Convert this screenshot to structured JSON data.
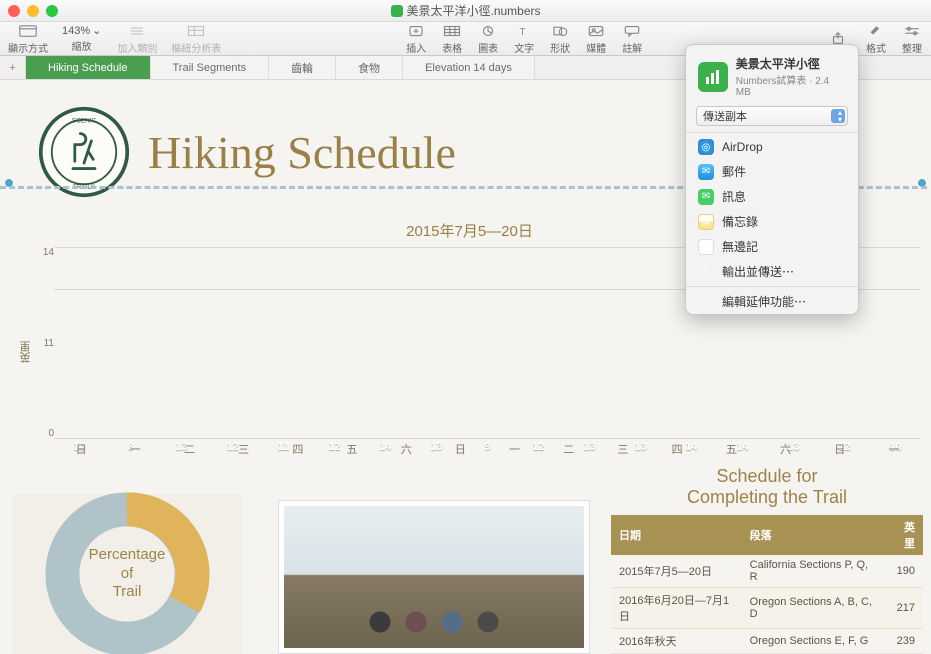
{
  "window": {
    "doc_title": "美景太平洋小徑.numbers"
  },
  "toolbar": {
    "view": "顯示方式",
    "zoom_level": "143%",
    "zoom_label": "縮放",
    "add_category": "加入類別",
    "pivot": "樞紐分析表",
    "insert": "插入",
    "table": "表格",
    "chart": "圖表",
    "text": "文字",
    "shape": "形狀",
    "media": "媒體",
    "comment": "註解",
    "share": "",
    "format": "格式",
    "organize": "整理"
  },
  "sheets": [
    "Hiking Schedule",
    "Trail Segments",
    "齒輪",
    "食物",
    "Elevation 14 days"
  ],
  "header": {
    "badge_top": "SCENIC",
    "badge_mid": "PACIFIC",
    "badge_bottom": "TRAILS",
    "title": "Hiking Schedule"
  },
  "chart_data": {
    "type": "bar",
    "subtitle": "2015年7月5—20日",
    "ylabel": "英里",
    "y_ticks": [
      14,
      11,
      0
    ],
    "ylim": [
      0,
      14
    ],
    "categories": [
      "日",
      "一",
      "二",
      "三",
      "四",
      "五",
      "六",
      "日",
      "一",
      "二",
      "三",
      "四",
      "五",
      "六",
      "日",
      "一"
    ],
    "values": [
      10,
      8,
      13,
      12,
      11,
      12,
      14,
      13,
      9,
      12,
      13,
      13,
      14,
      14,
      13,
      12,
      10
    ],
    "colors": [
      "c1",
      "c2",
      "c1",
      "c2",
      "c1",
      "c2",
      "c1",
      "c2",
      "c1",
      "c2",
      "c1",
      "c2",
      "c1",
      "c2",
      "c1",
      "c2",
      "c1"
    ]
  },
  "donut": {
    "line1": "Percentage",
    "line2": "of",
    "line3": "Trail"
  },
  "schedule": {
    "title1": "Schedule for",
    "title2": "Completing the Trail",
    "cols": [
      "日期",
      "段落",
      "英里"
    ],
    "rows": [
      [
        "2015年7月5—20日",
        "California Sections P, Q, R",
        "190"
      ],
      [
        "2016年6月20日—7月1日",
        "Oregon Sections A, B, C, D",
        "217"
      ],
      [
        "2016年秋天",
        "Oregon Sections E, F, G",
        "239"
      ]
    ]
  },
  "share": {
    "name": "美景太平洋小徑",
    "subtitle": "Numbers試算表 · 2.4 MB",
    "select": "傳送副本",
    "items": [
      {
        "icon": "airdrop",
        "label": "AirDrop"
      },
      {
        "icon": "mail",
        "label": "郵件"
      },
      {
        "icon": "msg",
        "label": "訊息"
      },
      {
        "icon": "notes",
        "label": "備忘錄"
      },
      {
        "icon": "wander",
        "label": "無邊記"
      },
      {
        "icon": "export",
        "label": "輸出並傳送⋯"
      }
    ],
    "edit": "編輯延伸功能⋯"
  }
}
